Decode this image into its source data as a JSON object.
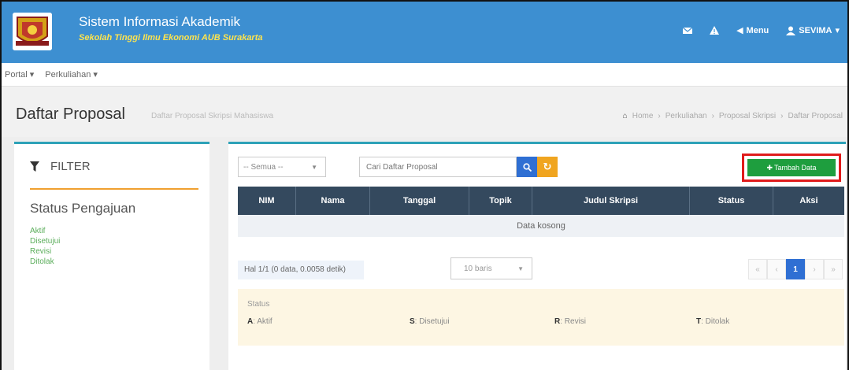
{
  "header": {
    "app_title": "Sistem Informasi Akademik",
    "app_subtitle": "Sekolah Tinggi Ilmu Ekonomi AUB Surakarta",
    "menu_label": "Menu",
    "user_label": "SEVIMA",
    "color": "#3d8fd1"
  },
  "nav": {
    "items": [
      {
        "label": "Portal"
      },
      {
        "label": "Perkuliahan"
      }
    ]
  },
  "page": {
    "title": "Daftar Proposal",
    "subtitle": "Daftar Proposal Skripsi Mahasiswa",
    "breadcrumb": [
      "Home",
      "Perkuliahan",
      "Proposal Skripsi",
      "Daftar Proposal"
    ]
  },
  "filter": {
    "heading": "FILTER",
    "title": "Status Pengajuan",
    "options": [
      "Aktif",
      "Disetujui",
      "Revisi",
      "Ditolak"
    ]
  },
  "toolbar": {
    "status_select": "-- Semua --",
    "search_placeholder": "Cari Daftar Proposal",
    "add_label": "Tambah Data",
    "add_color": "#1e9e3e",
    "highlight_color": "#e01b1b"
  },
  "table": {
    "columns": [
      "NIM",
      "Nama",
      "Tanggal",
      "Topik",
      "Judul Skripsi",
      "Status",
      "Aksi"
    ],
    "empty_text": "Data kosong"
  },
  "pagination": {
    "info": "Hal 1/1 (0 data, 0.0058 detik)",
    "rows_select": "10 baris",
    "current_page": "1",
    "first": "«",
    "prev": "‹",
    "next": "›",
    "last": "»"
  },
  "legend": {
    "title": "Status",
    "items": [
      {
        "code": "A",
        "label": ": Aktif"
      },
      {
        "code": "S",
        "label": ": Disetujui"
      },
      {
        "code": "R",
        "label": ": Revisi"
      },
      {
        "code": "T",
        "label": ": Ditolak"
      }
    ]
  }
}
